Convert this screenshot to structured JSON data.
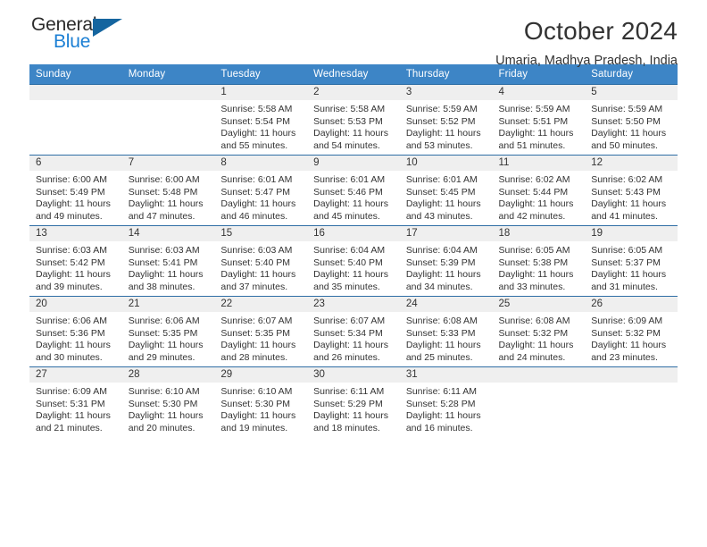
{
  "brand": {
    "name_top": "General",
    "name_bottom": "Blue",
    "triangle_color": "#15659f",
    "blue_text_color": "#1b7fd4"
  },
  "header": {
    "title": "October 2024",
    "subtitle": "Umaria, Madhya Pradesh, India"
  },
  "theme": {
    "header_row_bg": "#3d85c6",
    "day_band_bg": "#efefef",
    "row_divider": "#2f6ea5"
  },
  "weekday_headers": [
    "Sunday",
    "Monday",
    "Tuesday",
    "Wednesday",
    "Thursday",
    "Friday",
    "Saturday"
  ],
  "labels": {
    "sunrise_prefix": "Sunrise:",
    "sunset_prefix": "Sunset:",
    "daylight_prefix": "Daylight:"
  },
  "weeks": [
    [
      {
        "day": "",
        "sunrise": "",
        "sunset": "",
        "daylight_line1": "",
        "daylight_line2": ""
      },
      {
        "day": "",
        "sunrise": "",
        "sunset": "",
        "daylight_line1": "",
        "daylight_line2": ""
      },
      {
        "day": "1",
        "sunrise": "Sunrise: 5:58 AM",
        "sunset": "Sunset: 5:54 PM",
        "daylight_line1": "Daylight: 11 hours",
        "daylight_line2": "and 55 minutes."
      },
      {
        "day": "2",
        "sunrise": "Sunrise: 5:58 AM",
        "sunset": "Sunset: 5:53 PM",
        "daylight_line1": "Daylight: 11 hours",
        "daylight_line2": "and 54 minutes."
      },
      {
        "day": "3",
        "sunrise": "Sunrise: 5:59 AM",
        "sunset": "Sunset: 5:52 PM",
        "daylight_line1": "Daylight: 11 hours",
        "daylight_line2": "and 53 minutes."
      },
      {
        "day": "4",
        "sunrise": "Sunrise: 5:59 AM",
        "sunset": "Sunset: 5:51 PM",
        "daylight_line1": "Daylight: 11 hours",
        "daylight_line2": "and 51 minutes."
      },
      {
        "day": "5",
        "sunrise": "Sunrise: 5:59 AM",
        "sunset": "Sunset: 5:50 PM",
        "daylight_line1": "Daylight: 11 hours",
        "daylight_line2": "and 50 minutes."
      }
    ],
    [
      {
        "day": "6",
        "sunrise": "Sunrise: 6:00 AM",
        "sunset": "Sunset: 5:49 PM",
        "daylight_line1": "Daylight: 11 hours",
        "daylight_line2": "and 49 minutes."
      },
      {
        "day": "7",
        "sunrise": "Sunrise: 6:00 AM",
        "sunset": "Sunset: 5:48 PM",
        "daylight_line1": "Daylight: 11 hours",
        "daylight_line2": "and 47 minutes."
      },
      {
        "day": "8",
        "sunrise": "Sunrise: 6:01 AM",
        "sunset": "Sunset: 5:47 PM",
        "daylight_line1": "Daylight: 11 hours",
        "daylight_line2": "and 46 minutes."
      },
      {
        "day": "9",
        "sunrise": "Sunrise: 6:01 AM",
        "sunset": "Sunset: 5:46 PM",
        "daylight_line1": "Daylight: 11 hours",
        "daylight_line2": "and 45 minutes."
      },
      {
        "day": "10",
        "sunrise": "Sunrise: 6:01 AM",
        "sunset": "Sunset: 5:45 PM",
        "daylight_line1": "Daylight: 11 hours",
        "daylight_line2": "and 43 minutes."
      },
      {
        "day": "11",
        "sunrise": "Sunrise: 6:02 AM",
        "sunset": "Sunset: 5:44 PM",
        "daylight_line1": "Daylight: 11 hours",
        "daylight_line2": "and 42 minutes."
      },
      {
        "day": "12",
        "sunrise": "Sunrise: 6:02 AM",
        "sunset": "Sunset: 5:43 PM",
        "daylight_line1": "Daylight: 11 hours",
        "daylight_line2": "and 41 minutes."
      }
    ],
    [
      {
        "day": "13",
        "sunrise": "Sunrise: 6:03 AM",
        "sunset": "Sunset: 5:42 PM",
        "daylight_line1": "Daylight: 11 hours",
        "daylight_line2": "and 39 minutes."
      },
      {
        "day": "14",
        "sunrise": "Sunrise: 6:03 AM",
        "sunset": "Sunset: 5:41 PM",
        "daylight_line1": "Daylight: 11 hours",
        "daylight_line2": "and 38 minutes."
      },
      {
        "day": "15",
        "sunrise": "Sunrise: 6:03 AM",
        "sunset": "Sunset: 5:40 PM",
        "daylight_line1": "Daylight: 11 hours",
        "daylight_line2": "and 37 minutes."
      },
      {
        "day": "16",
        "sunrise": "Sunrise: 6:04 AM",
        "sunset": "Sunset: 5:40 PM",
        "daylight_line1": "Daylight: 11 hours",
        "daylight_line2": "and 35 minutes."
      },
      {
        "day": "17",
        "sunrise": "Sunrise: 6:04 AM",
        "sunset": "Sunset: 5:39 PM",
        "daylight_line1": "Daylight: 11 hours",
        "daylight_line2": "and 34 minutes."
      },
      {
        "day": "18",
        "sunrise": "Sunrise: 6:05 AM",
        "sunset": "Sunset: 5:38 PM",
        "daylight_line1": "Daylight: 11 hours",
        "daylight_line2": "and 33 minutes."
      },
      {
        "day": "19",
        "sunrise": "Sunrise: 6:05 AM",
        "sunset": "Sunset: 5:37 PM",
        "daylight_line1": "Daylight: 11 hours",
        "daylight_line2": "and 31 minutes."
      }
    ],
    [
      {
        "day": "20",
        "sunrise": "Sunrise: 6:06 AM",
        "sunset": "Sunset: 5:36 PM",
        "daylight_line1": "Daylight: 11 hours",
        "daylight_line2": "and 30 minutes."
      },
      {
        "day": "21",
        "sunrise": "Sunrise: 6:06 AM",
        "sunset": "Sunset: 5:35 PM",
        "daylight_line1": "Daylight: 11 hours",
        "daylight_line2": "and 29 minutes."
      },
      {
        "day": "22",
        "sunrise": "Sunrise: 6:07 AM",
        "sunset": "Sunset: 5:35 PM",
        "daylight_line1": "Daylight: 11 hours",
        "daylight_line2": "and 28 minutes."
      },
      {
        "day": "23",
        "sunrise": "Sunrise: 6:07 AM",
        "sunset": "Sunset: 5:34 PM",
        "daylight_line1": "Daylight: 11 hours",
        "daylight_line2": "and 26 minutes."
      },
      {
        "day": "24",
        "sunrise": "Sunrise: 6:08 AM",
        "sunset": "Sunset: 5:33 PM",
        "daylight_line1": "Daylight: 11 hours",
        "daylight_line2": "and 25 minutes."
      },
      {
        "day": "25",
        "sunrise": "Sunrise: 6:08 AM",
        "sunset": "Sunset: 5:32 PM",
        "daylight_line1": "Daylight: 11 hours",
        "daylight_line2": "and 24 minutes."
      },
      {
        "day": "26",
        "sunrise": "Sunrise: 6:09 AM",
        "sunset": "Sunset: 5:32 PM",
        "daylight_line1": "Daylight: 11 hours",
        "daylight_line2": "and 23 minutes."
      }
    ],
    [
      {
        "day": "27",
        "sunrise": "Sunrise: 6:09 AM",
        "sunset": "Sunset: 5:31 PM",
        "daylight_line1": "Daylight: 11 hours",
        "daylight_line2": "and 21 minutes."
      },
      {
        "day": "28",
        "sunrise": "Sunrise: 6:10 AM",
        "sunset": "Sunset: 5:30 PM",
        "daylight_line1": "Daylight: 11 hours",
        "daylight_line2": "and 20 minutes."
      },
      {
        "day": "29",
        "sunrise": "Sunrise: 6:10 AM",
        "sunset": "Sunset: 5:30 PM",
        "daylight_line1": "Daylight: 11 hours",
        "daylight_line2": "and 19 minutes."
      },
      {
        "day": "30",
        "sunrise": "Sunrise: 6:11 AM",
        "sunset": "Sunset: 5:29 PM",
        "daylight_line1": "Daylight: 11 hours",
        "daylight_line2": "and 18 minutes."
      },
      {
        "day": "31",
        "sunrise": "Sunrise: 6:11 AM",
        "sunset": "Sunset: 5:28 PM",
        "daylight_line1": "Daylight: 11 hours",
        "daylight_line2": "and 16 minutes."
      },
      {
        "day": "",
        "sunrise": "",
        "sunset": "",
        "daylight_line1": "",
        "daylight_line2": ""
      },
      {
        "day": "",
        "sunrise": "",
        "sunset": "",
        "daylight_line1": "",
        "daylight_line2": ""
      }
    ]
  ]
}
